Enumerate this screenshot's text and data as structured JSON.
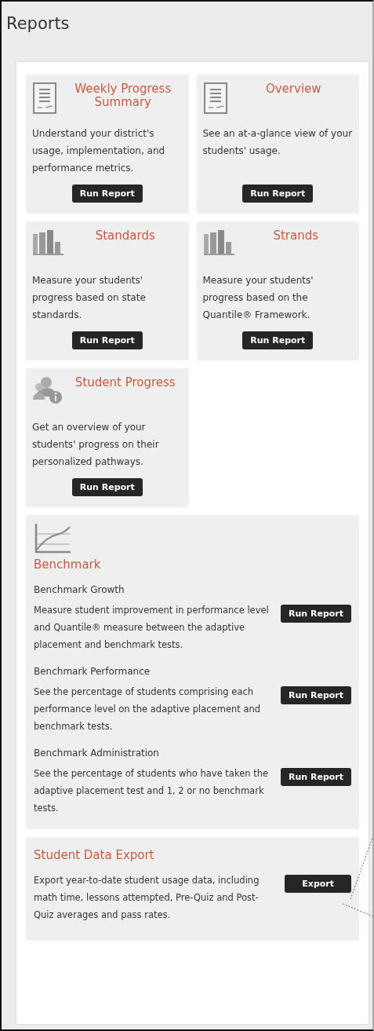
{
  "page": {
    "title": "Reports"
  },
  "report_cards": [
    {
      "kind": "document",
      "title": "Weekly Progress Summary",
      "description": "Understand your district's usage, implementation, and performance metrics.",
      "button": "Run Report"
    },
    {
      "kind": "document",
      "title": "Overview",
      "description": "See an at-a-glance view of your students' usage.",
      "button": "Run Report"
    },
    {
      "kind": "bars",
      "title": "Standards",
      "description": "Measure your students' progress based on state standards.",
      "button": "Run Report"
    },
    {
      "kind": "bars",
      "title": "Strands",
      "description": "Measure your students' progress based on the Quantile® Framework.",
      "button": "Run Report"
    },
    {
      "kind": "people",
      "title": "Student Progress",
      "description": "Get an overview of your students' progress on their personalized pathways.",
      "button": "Run Report"
    }
  ],
  "benchmark": {
    "title": "Benchmark",
    "items": [
      {
        "name": "Benchmark Growth",
        "description": "Measure student improvement in performance level and Quantile® measure between the adaptive placement and benchmark tests.",
        "button": "Run Report"
      },
      {
        "name": "Benchmark Performance",
        "description": "See the percentage of students comprising each performance level on the adaptive placement and benchmark tests.",
        "button": "Run Report"
      },
      {
        "name": "Benchmark Administration",
        "description": "See the percentage of students who have taken the adaptive placement test and 1, 2 or no benchmark tests.",
        "button": "Run Report"
      }
    ]
  },
  "export": {
    "title": "Student Data Export",
    "description": "Export year-to-date student usage data, including math time, lessons attempted, Pre-Quiz and Post-Quiz averages and pass rates.",
    "button": "Export"
  }
}
